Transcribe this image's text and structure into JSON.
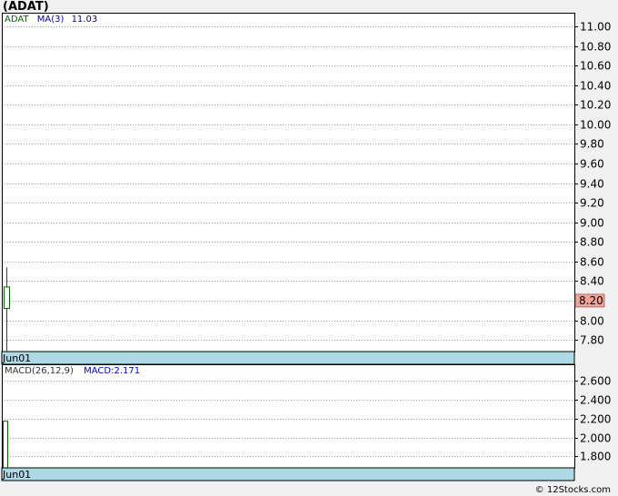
{
  "title": "(ADAT)",
  "credit": "© 12Stocks.com",
  "colors": {
    "price_up": "#006600",
    "ma_label": "#0000aa",
    "macd_label": "#333333",
    "macd_value": "#0000cc",
    "last_price_bg": "#f3a39a",
    "date_band": "#add8e6",
    "grid": "#9a9a9a"
  },
  "chart_data": [
    {
      "type": "candlestick",
      "series_name": "ADAT",
      "indicator_label": "MA(3)",
      "indicator_value": "11.03",
      "last_price": "8.20",
      "ylim": [
        7.68,
        11.14
      ],
      "yticks": [
        7.8,
        8.0,
        8.2,
        8.4,
        8.6,
        8.8,
        9.0,
        9.2,
        9.4,
        9.6,
        9.8,
        10.0,
        10.2,
        10.4,
        10.6,
        10.8,
        11.0
      ],
      "ytick_labels": [
        "7.80",
        "8.00",
        "8.20",
        "8.40",
        "8.60",
        "8.80",
        "9.00",
        "9.20",
        "9.40",
        "9.60",
        "9.80",
        "10.00",
        "10.20",
        "10.40",
        "10.60",
        "10.80",
        "11.00"
      ],
      "x_label": "Jun01",
      "candles": [
        {
          "open": 8.12,
          "high": 8.54,
          "low": 7.68,
          "close": 8.34
        }
      ],
      "grid": true
    },
    {
      "type": "bar",
      "series_name": "MACD(26,12,9)",
      "indicator_label": "MACD:2.171",
      "ylim": [
        1.68,
        2.77
      ],
      "yticks": [
        1.8,
        2.0,
        2.2,
        2.4,
        2.6
      ],
      "ytick_labels": [
        "1.800",
        "2.000",
        "2.200",
        "2.400",
        "2.600"
      ],
      "x_label": "Jun01",
      "values": [
        2.171
      ],
      "grid": true
    }
  ]
}
